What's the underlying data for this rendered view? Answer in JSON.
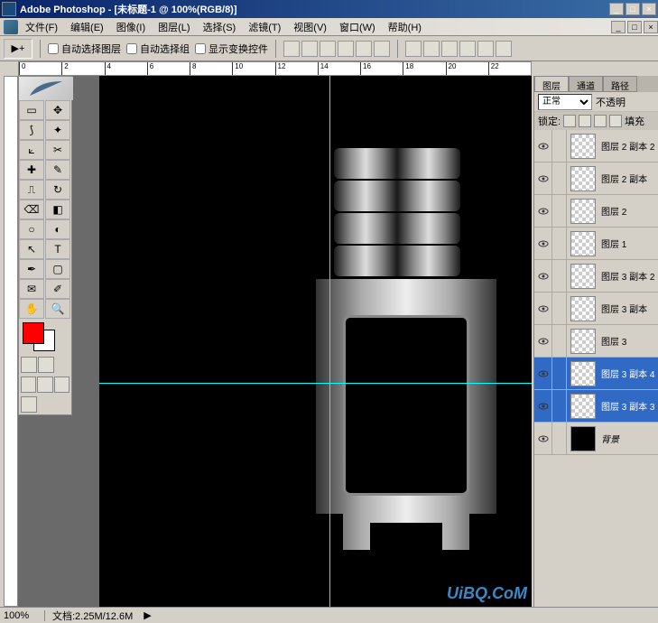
{
  "title": "Adobe Photoshop - [未标题-1 @ 100%(RGB/8)]",
  "menus": [
    "文件(F)",
    "编辑(E)",
    "图像(I)",
    "图层(L)",
    "选择(S)",
    "滤镜(T)",
    "视图(V)",
    "窗口(W)",
    "帮助(H)"
  ],
  "options": {
    "auto_select_layer": "自动选择图层",
    "auto_select_group": "自动选择组",
    "show_transform": "显示变换控件"
  },
  "ruler_marks": [
    "0",
    "2",
    "4",
    "6",
    "8",
    "10",
    "12",
    "14",
    "16",
    "18",
    "20",
    "22"
  ],
  "panels": {
    "tabs": [
      "图层",
      "通道",
      "路径"
    ],
    "blend_mode": "正常",
    "opacity_label": "不透明",
    "lock_label": "锁定:",
    "fill_label": "填充",
    "layers": [
      {
        "name": "图层 2 副本 2",
        "selected": false,
        "thumb": "checker"
      },
      {
        "name": "图层 2 副本",
        "selected": false,
        "thumb": "checker"
      },
      {
        "name": "图层 2",
        "selected": false,
        "thumb": "checker"
      },
      {
        "name": "图层 1",
        "selected": false,
        "thumb": "checker"
      },
      {
        "name": "图层 3 副本 2",
        "selected": false,
        "thumb": "checker"
      },
      {
        "name": "图层 3 副本",
        "selected": false,
        "thumb": "checker"
      },
      {
        "name": "图层 3",
        "selected": false,
        "thumb": "checker"
      },
      {
        "name": "图层 3 副本 4",
        "selected": true,
        "thumb": "checker"
      },
      {
        "name": "图层 3 副本 3",
        "selected": true,
        "thumb": "checker"
      },
      {
        "name": "背景",
        "selected": false,
        "thumb": "black",
        "italic": true
      }
    ]
  },
  "status": {
    "zoom": "100%",
    "doc": "文档:2.25M/12.6M"
  },
  "colors": {
    "foreground": "#ff0000",
    "background": "#ffffff"
  },
  "watermark": "UiBQ.CoM"
}
